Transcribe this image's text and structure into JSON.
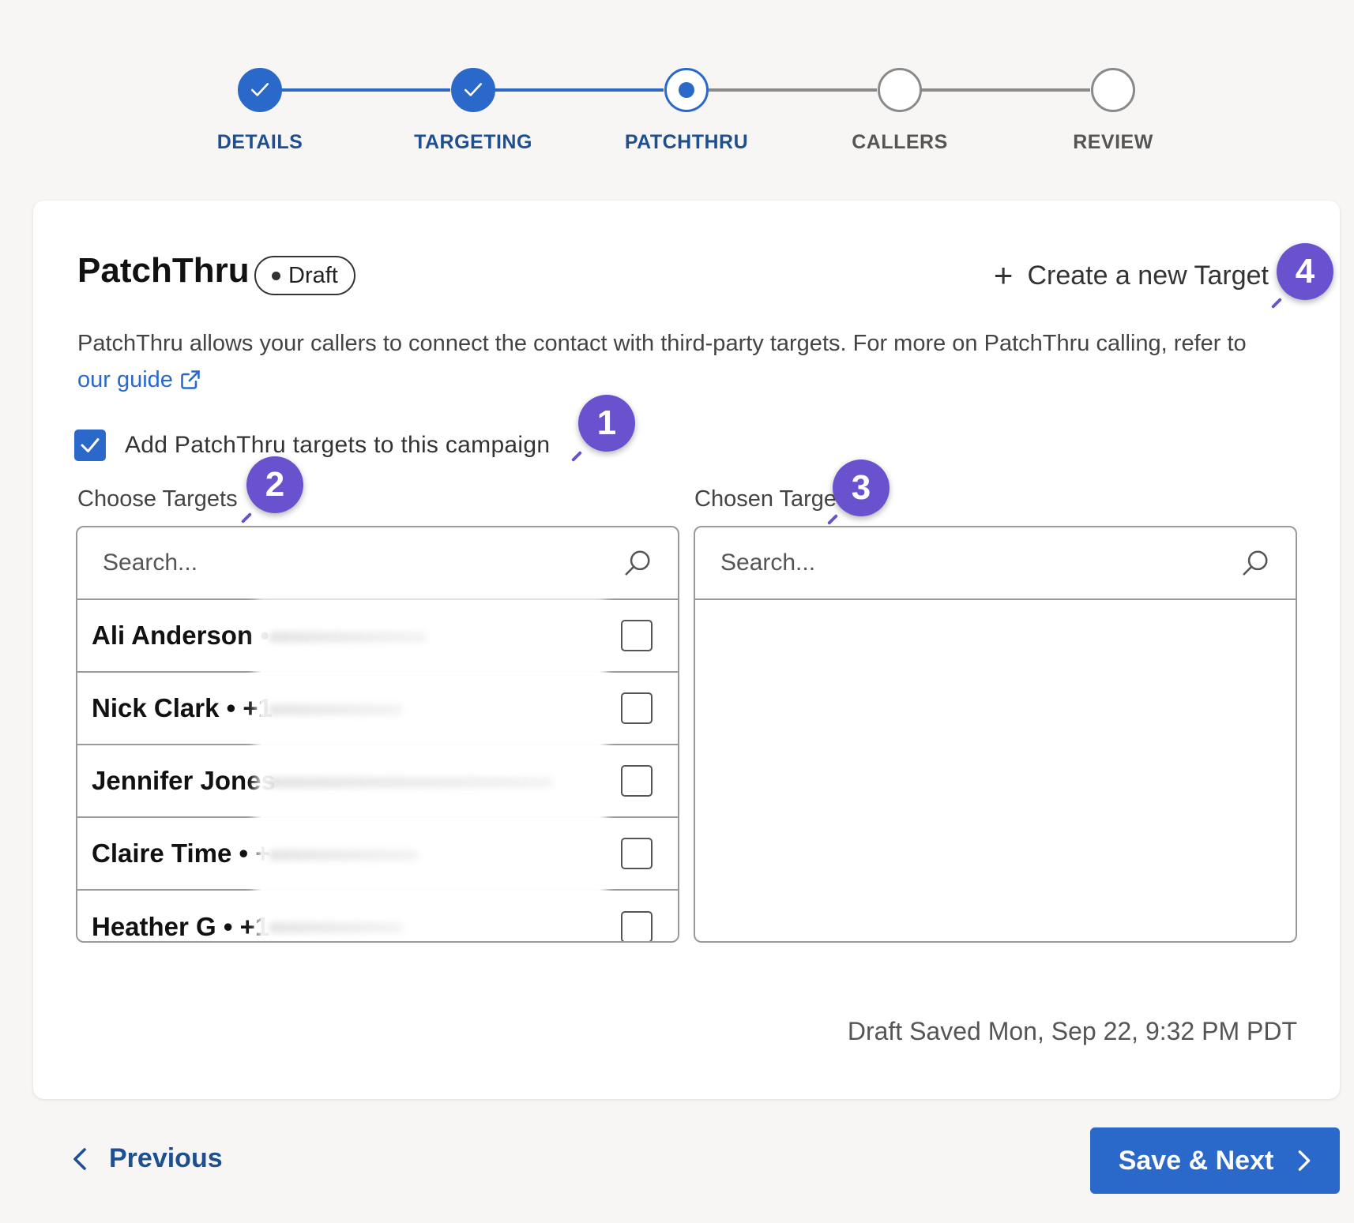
{
  "stepper": {
    "steps": [
      {
        "label": "DETAILS",
        "state": "done"
      },
      {
        "label": "TARGETING",
        "state": "done"
      },
      {
        "label": "PATCHTHRU",
        "state": "current"
      },
      {
        "label": "CALLERS",
        "state": "todo"
      },
      {
        "label": "REVIEW",
        "state": "todo"
      }
    ]
  },
  "header": {
    "title": "PatchThru",
    "badge": "Draft",
    "create_target": "Create a new Target"
  },
  "description": {
    "text": "PatchThru allows your callers to connect the contact with third-party targets. For more on PatchThru calling, refer to",
    "link": "our guide"
  },
  "add_targets": {
    "label": "Add PatchThru targets to this campaign",
    "checked": true
  },
  "choose": {
    "label": "Choose Targets",
    "search_placeholder": "Search...",
    "items": [
      {
        "name": "Ali Anderson •"
      },
      {
        "name": "Nick Clark • +1"
      },
      {
        "name": "Jennifer Jones"
      },
      {
        "name": "Claire Time • +"
      },
      {
        "name": "Heather G • +1"
      }
    ]
  },
  "chosen": {
    "label": "Chosen Targets",
    "search_placeholder": "Search..."
  },
  "saved_text": "Draft Saved Mon, Sep 22, 9:32 PM PDT",
  "annotations": [
    "1",
    "2",
    "3",
    "4"
  ],
  "footer": {
    "previous": "Previous",
    "next": "Save & Next"
  },
  "colors": {
    "primary": "#2a69c9",
    "annotation": "#6a52cf",
    "step_label": "#1d4f91"
  }
}
